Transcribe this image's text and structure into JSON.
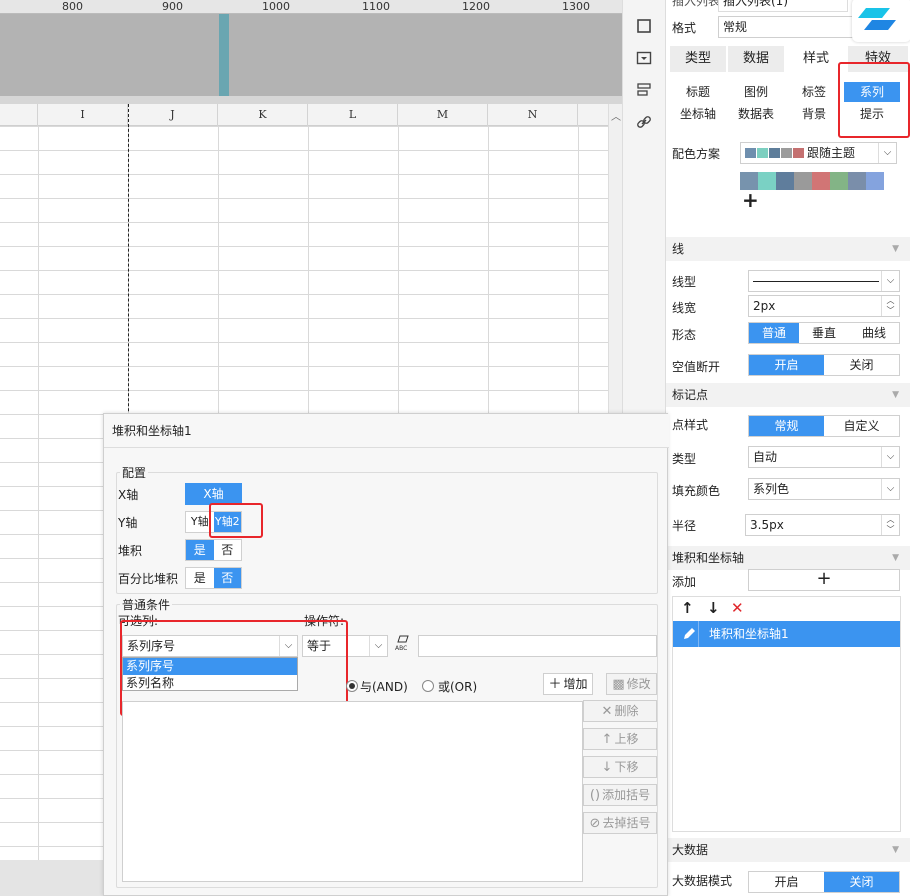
{
  "ruler": {
    "labels": [
      "800",
      "900",
      "1000",
      "1100",
      "1200",
      "1300"
    ]
  },
  "sheet": {
    "columns": [
      "I",
      "J",
      "K",
      "L",
      "M",
      "N"
    ]
  },
  "panel": {
    "top_label_cut": "插入列表",
    "top_value_cut": "插入列表(1)",
    "format_label": "格式",
    "format_value": "常规",
    "tabs": [
      "类型",
      "数据",
      "样式",
      "特效"
    ],
    "subtabs_row1": [
      "标题",
      "图例",
      "标签",
      "系列"
    ],
    "subtabs_row2": [
      "坐标轴",
      "数据表",
      "背景",
      "提示"
    ],
    "color_scheme_label": "配色方案",
    "color_scheme_value": "跟随主题",
    "palette": [
      "#7793ad",
      "#7ad1c4",
      "#5f7d9c",
      "#9a9a9a",
      "#d17575",
      "#83b486",
      "#7a8eaa",
      "#84a3de"
    ],
    "small_swatches": [
      "#6f8fae",
      "#7ccfc0",
      "#5e7d9a",
      "#9b9b9b",
      "#c47070"
    ],
    "plus": "+",
    "section_line": "线",
    "line_type_label": "线型",
    "line_width_label": "线宽",
    "line_width_value": "2px",
    "shape_label": "形态",
    "shape_opts": [
      "普通",
      "垂直",
      "曲线"
    ],
    "null_break_label": "空值断开",
    "null_break_opts": [
      "开启",
      "关闭"
    ],
    "section_marker": "标记点",
    "point_style_label": "点样式",
    "point_style_opts": [
      "常规",
      "自定义"
    ],
    "type_label": "类型",
    "type_value": "自动",
    "fill_color_label": "填充颜色",
    "fill_color_value": "系列色",
    "radius_label": "半径",
    "radius_value": "3.5px",
    "section_stack": "堆积和坐标轴",
    "add_label": "添加",
    "add_plus": "+",
    "up_arrow": "↑",
    "down_arrow": "↓",
    "delete_x": "✕",
    "stack_item": "堆积和坐标轴1",
    "section_bigdata": "大数据",
    "bigdata_mode_label": "大数据模式",
    "bigdata_opts": [
      "开启",
      "关闭"
    ]
  },
  "dialog": {
    "title": "堆积和坐标轴1",
    "config_legend": "配置",
    "x_axis_label": "X轴",
    "x_axis_value": "X轴",
    "y_axis_label": "Y轴",
    "y_axis_opts": [
      "Y轴",
      "Y轴2"
    ],
    "stack_label": "堆积",
    "stack_opts": [
      "是",
      "否"
    ],
    "percent_label": "百分比堆积",
    "percent_opts": [
      "是",
      "否"
    ],
    "cond_legend": "普通条件",
    "col_label": "可选列:",
    "op_label": "操作符:",
    "col_value": "系列序号",
    "col_options": [
      "系列序号",
      "系列名称"
    ],
    "op_value": "等于",
    "and_label": "与(AND)",
    "or_label": "或(OR)",
    "btn_add": "增加",
    "btn_edit": "修改",
    "btn_delete": "删除",
    "btn_up": "上移",
    "btn_down": "下移",
    "btn_add_paren": "添加括号",
    "btn_remove_paren": "去掉括号"
  },
  "colors": {
    "accent": "#3b94f0",
    "highlight_box": "#e8262b"
  }
}
